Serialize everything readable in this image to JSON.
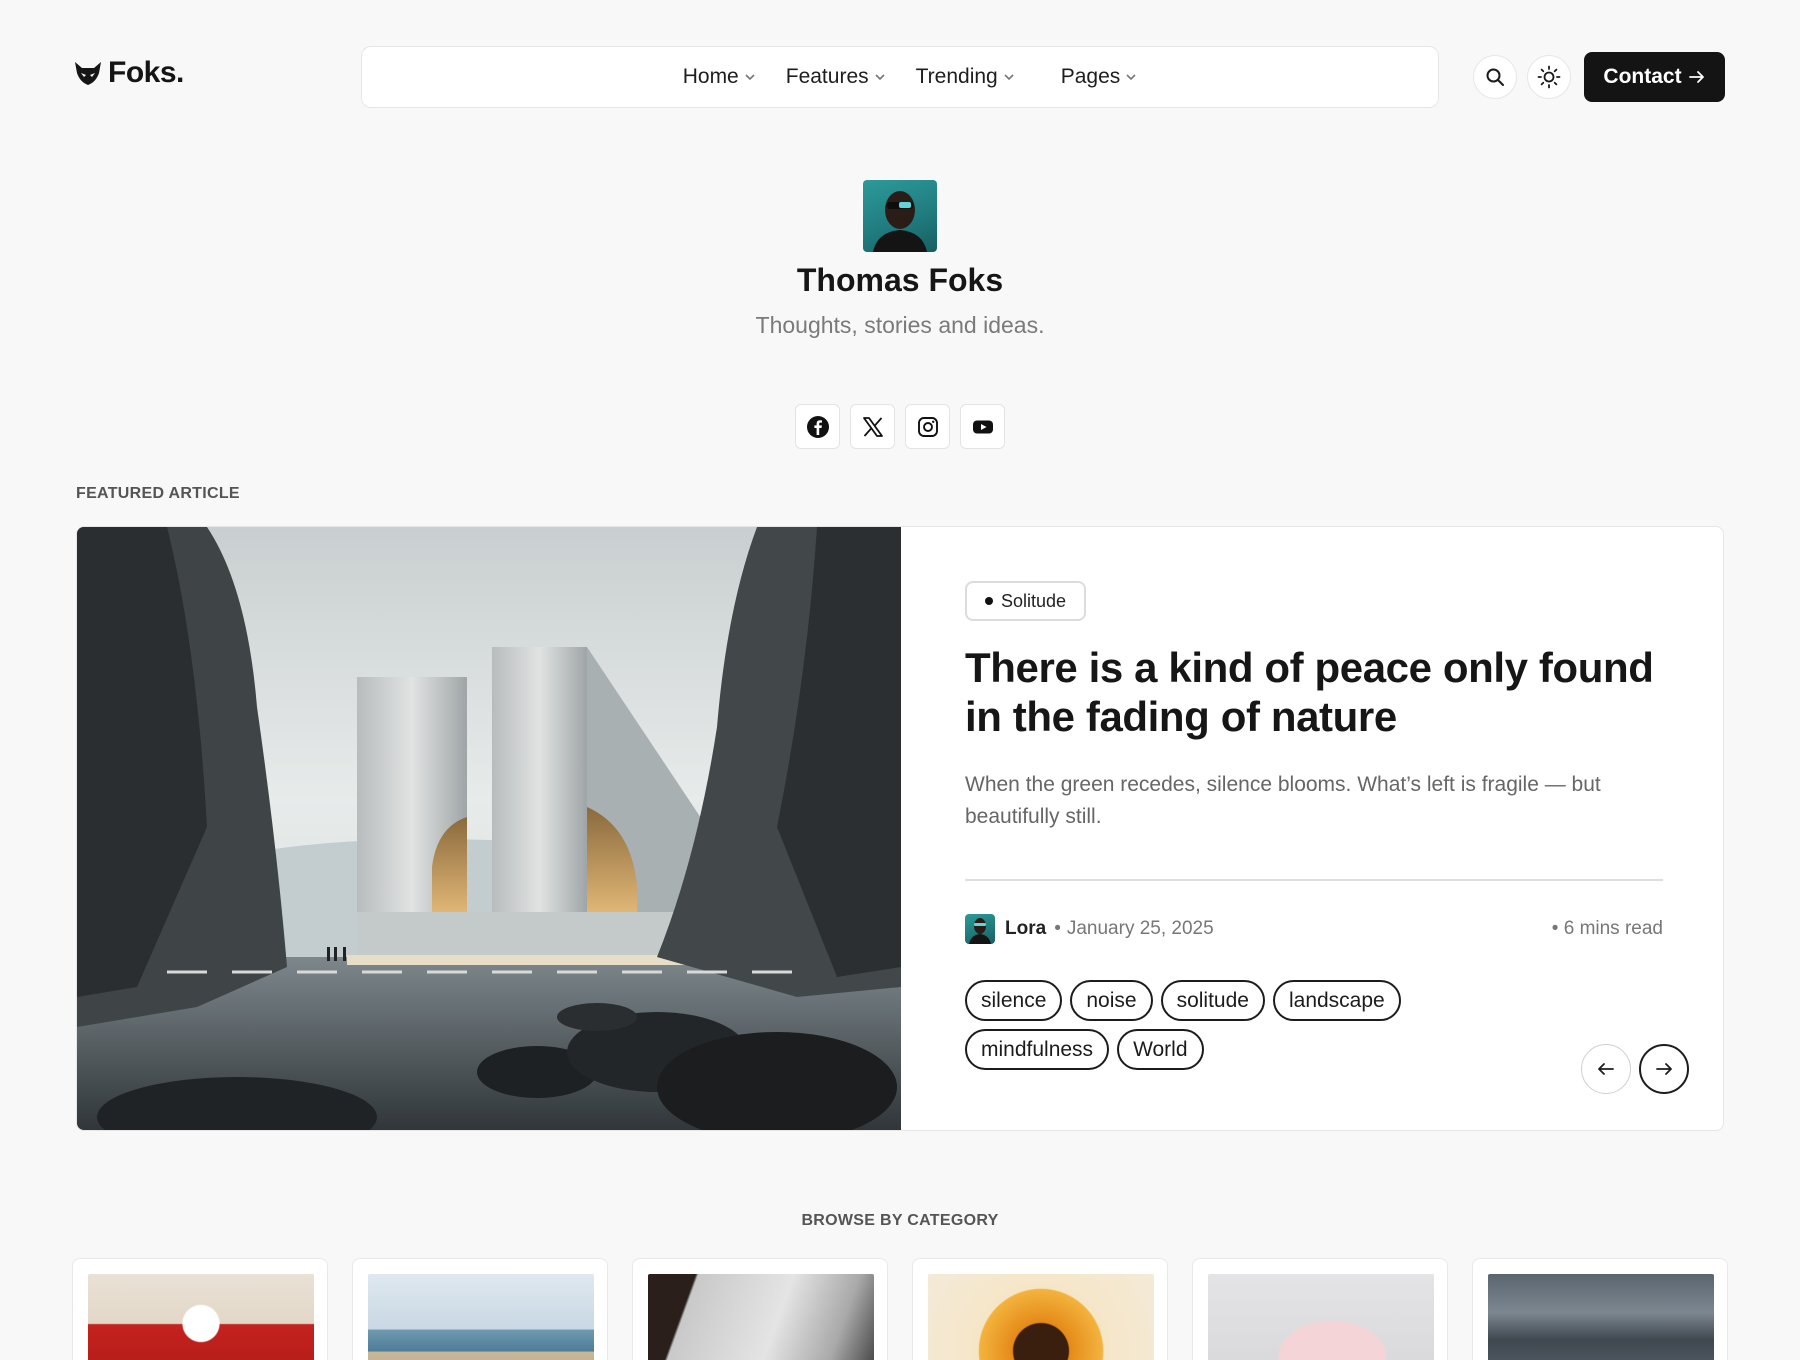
{
  "brand": {
    "name": "Foks."
  },
  "nav": {
    "items": [
      {
        "label": "Home"
      },
      {
        "label": "Features"
      },
      {
        "label": "Trending"
      },
      {
        "label": "Pages"
      }
    ],
    "contact_label": "Contact"
  },
  "icons": {
    "search": "search-icon",
    "theme": "sun-icon",
    "contact_arrow": "arrow-right-icon",
    "socials": [
      "facebook-icon",
      "x-icon",
      "instagram-icon",
      "youtube-icon"
    ],
    "prev": "arrow-left-icon",
    "next": "arrow-right-icon"
  },
  "profile": {
    "name": "Thomas Foks",
    "tagline": "Thoughts, stories and ideas."
  },
  "featured": {
    "section_label": "FEATURED ARTICLE",
    "category": "Solitude",
    "title": "There is a kind of peace only found in the fading of nature",
    "excerpt": "When the green recedes, silence blooms. What’s left is fragile — but beautifully still.",
    "author": "Lora",
    "date": "January 25, 2025",
    "read_time": "6 mins read",
    "tags": [
      "silence",
      "noise",
      "solitude",
      "landscape",
      "mindfulness",
      "World"
    ]
  },
  "browse": {
    "section_label": "BROWSE BY CATEGORY"
  },
  "colors": {
    "background": "#f8f8f8",
    "dark": "#141414",
    "accent_teal": "#2d9a9a"
  }
}
